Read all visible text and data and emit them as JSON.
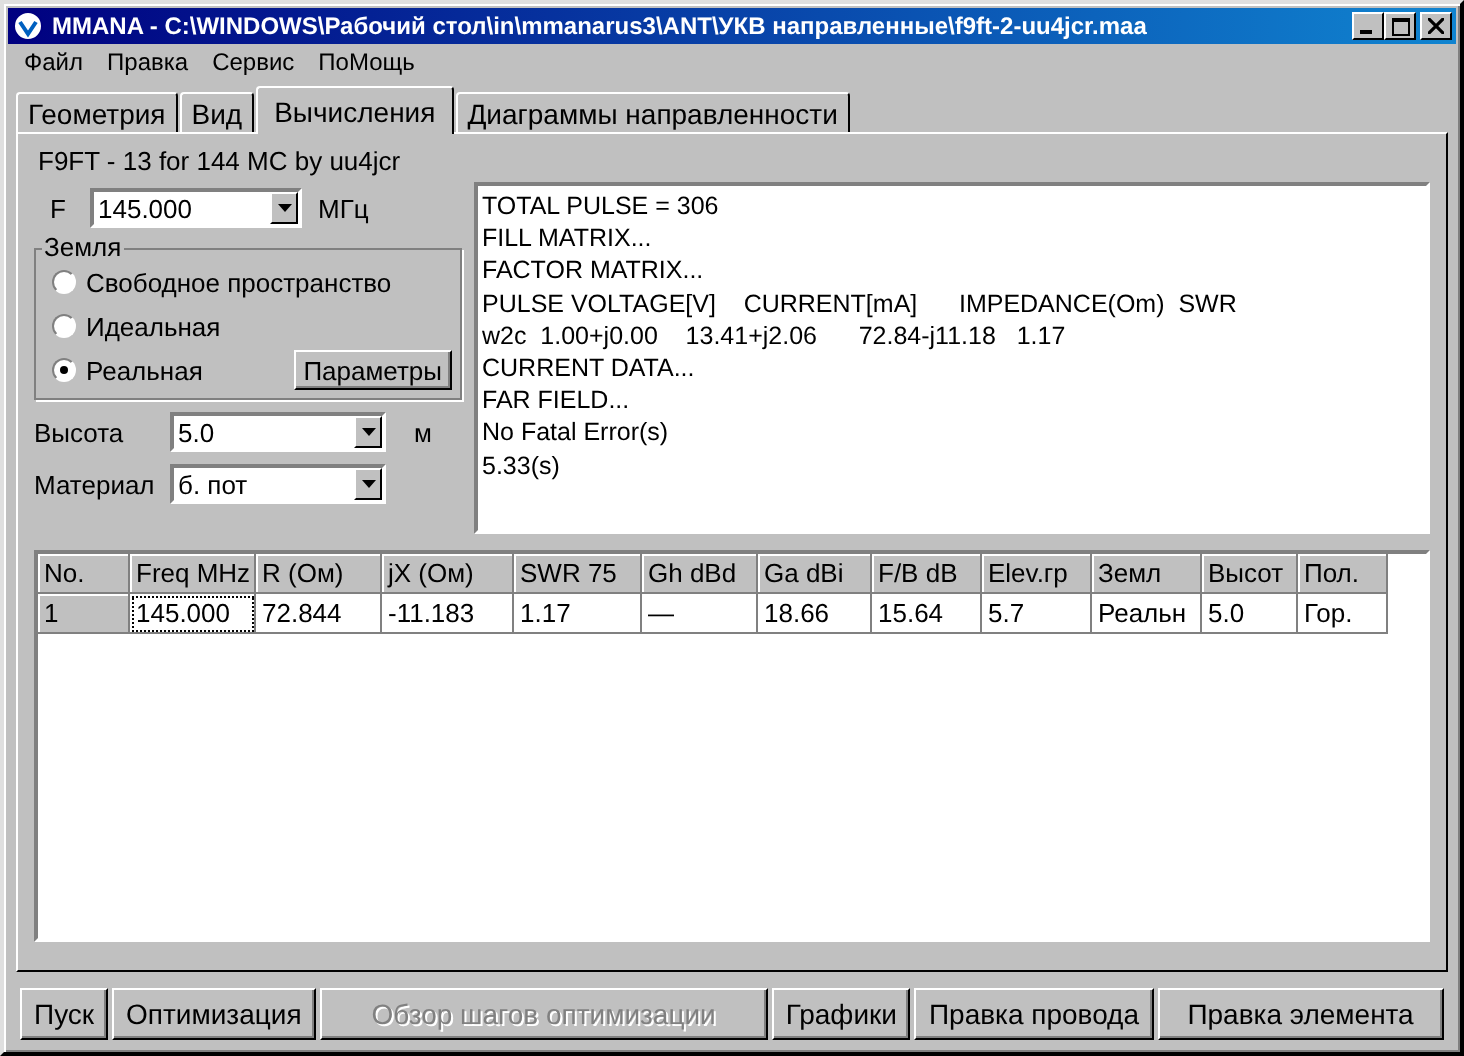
{
  "window": {
    "title": "MMANA - C:\\WINDOWS\\Рабочий стол\\in\\mmanarus3\\ANT\\УКВ направленные\\f9ft-2-uu4jcr.maa"
  },
  "menu": [
    "Файл",
    "Правка",
    "Сервис",
    "ПоМощь"
  ],
  "tabs": [
    {
      "label": "Геометрия",
      "selected": false
    },
    {
      "label": "Вид",
      "selected": false
    },
    {
      "label": "Вычисления",
      "selected": true
    },
    {
      "label": "Диаграммы направленности",
      "selected": false
    }
  ],
  "antenna_name": "F9FT - 13 for 144 MC by uu4jcr",
  "frequency": {
    "label": "F",
    "value": "145.000",
    "unit": "МГц"
  },
  "ground": {
    "title": "Земля",
    "options": [
      {
        "label": "Свободное пространство",
        "selected": false
      },
      {
        "label": "Идеальная",
        "selected": false
      },
      {
        "label": "Реальная",
        "selected": true
      }
    ],
    "button": "Параметры"
  },
  "height": {
    "label": "Высота",
    "value": "5.0",
    "unit": "м"
  },
  "material": {
    "label": "Материал",
    "value": "б. пот"
  },
  "output": [
    "TOTAL PULSE = 306",
    "FILL MATRIX...",
    "FACTOR MATRIX...",
    "PULSE VOLTAGE[V]    CURRENT[mA]      IMPEDANCE(Om)  SWR",
    "w2c  1.00+j0.00    13.41+j2.06      72.84-j11.18   1.17",
    "CURRENT DATA...",
    "FAR FIELD...",
    "No Fatal Error(s)",
    "5.33(s)"
  ],
  "table": {
    "columns": [
      "No.",
      "Freq MHz",
      "R (Ом)",
      "jX (Ом)",
      "SWR 75",
      "Gh dBd",
      "Ga dBi",
      "F/B dB",
      "Elev.гр",
      "Земл",
      "Высот",
      "Пол."
    ],
    "rows": [
      [
        "1",
        "145.000",
        "72.844",
        "-11.183",
        "1.17",
        "—",
        "18.66",
        "15.64",
        "5.7",
        "Реальн",
        "5.0",
        "Гор."
      ]
    ]
  },
  "buttons": [
    {
      "label": "Пуск",
      "disabled": false
    },
    {
      "label": "Оптимизация",
      "disabled": false
    },
    {
      "label": "Обзор шагов оптимизации",
      "disabled": true
    },
    {
      "label": "Графики",
      "disabled": false
    },
    {
      "label": "Правка провода",
      "disabled": false
    },
    {
      "label": "Правка элемента",
      "disabled": false
    }
  ]
}
